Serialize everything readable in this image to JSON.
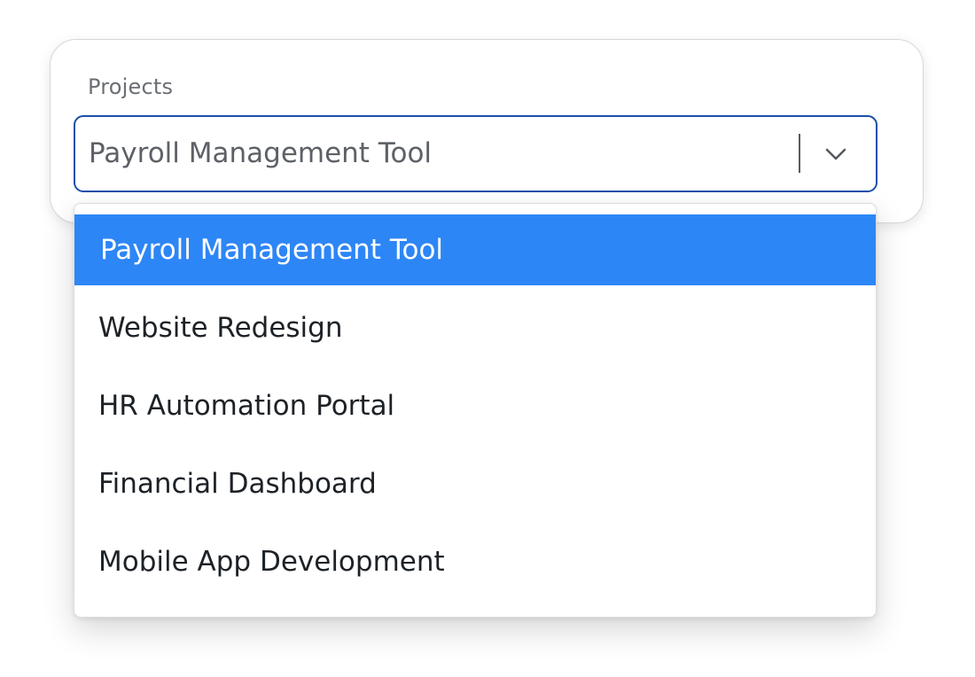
{
  "field": {
    "label": "Projects",
    "selected_value": "Payroll Management Tool"
  },
  "icons": {
    "dropdown_indicator": "chevron-down-icon"
  },
  "colors": {
    "select_border": "#1a4fa9",
    "highlight": "#2d86f5"
  },
  "dropdown": {
    "highlighted_index": 0,
    "options": [
      {
        "label": "Payroll Management Tool"
      },
      {
        "label": "Website Redesign"
      },
      {
        "label": "HR Automation Portal"
      },
      {
        "label": "Financial Dashboard"
      },
      {
        "label": "Mobile App Development"
      }
    ]
  }
}
